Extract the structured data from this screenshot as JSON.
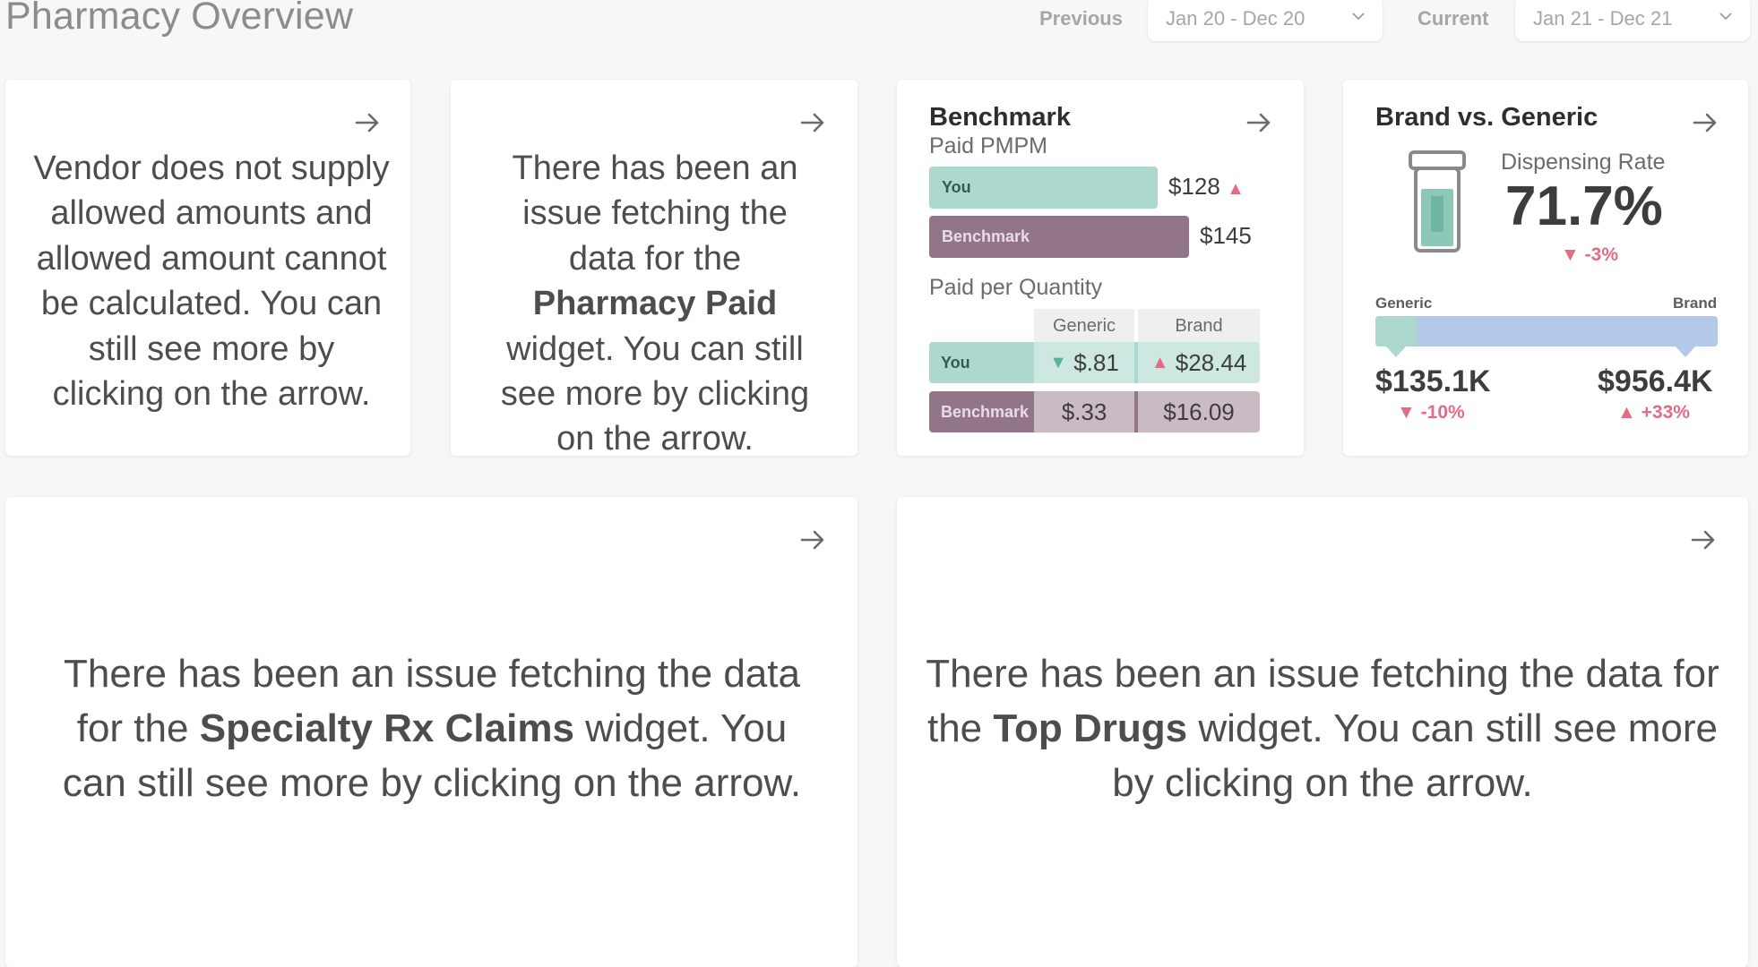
{
  "page": {
    "title": "Pharmacy Overview"
  },
  "filters": {
    "previous_label": "Previous",
    "previous_value": "Jan 20 - Dec 20",
    "current_label": "Current",
    "current_value": "Jan 21 - Dec 21"
  },
  "cards": {
    "allowed": {
      "message": "Vendor does not supply allowed amounts and allowed amount cannot be calculated. You can still see more by clicking on the arrow."
    },
    "pharmacy_paid": {
      "msg_pre": "There has been an issue fetching the data for the",
      "msg_bold": "Pharmacy Paid",
      "msg_post": "widget. You can still see more by clicking on the arrow."
    },
    "benchmark": {
      "title": "Benchmark",
      "paid_pmpm_label": "Paid PMPM",
      "you_label": "You",
      "you_value": "$128",
      "benchmark_label": "Benchmark",
      "benchmark_value": "$145",
      "paid_per_quantity_label": "Paid per Quantity",
      "col_generic": "Generic",
      "col_brand": "Brand",
      "row_you_label": "You",
      "row_you_generic": "$.81",
      "row_you_brand": "$28.44",
      "row_bm_label": "Benchmark",
      "row_bm_generic": "$.33",
      "row_bm_brand": "$16.09"
    },
    "brand_generic": {
      "title": "Brand vs. Generic",
      "dispensing_rate_label": "Dispensing Rate",
      "dispensing_rate": "71.7%",
      "dispensing_change": "-3%",
      "generic_label": "Generic",
      "brand_label": "Brand",
      "generic_value": "$135.1K",
      "generic_change": "-10%",
      "brand_value": "$956.4K",
      "brand_change": "+33%"
    },
    "specialty": {
      "msg_pre": "There has been an issue fetching the data for the",
      "msg_bold": "Specialty Rx Claims",
      "msg_post": "widget. You can still see more by clicking on the arrow."
    },
    "top_drugs": {
      "msg_pre": "There has been an issue fetching the data for the",
      "msg_bold": "Top Drugs",
      "msg_post": "widget. You can still see more by clicking on the arrow."
    }
  },
  "colors": {
    "you": "#acd8cf",
    "benchmark": "#927589",
    "generic": "#acd8cf",
    "brand": "#b4c8ea",
    "negative": "#e26c84"
  }
}
